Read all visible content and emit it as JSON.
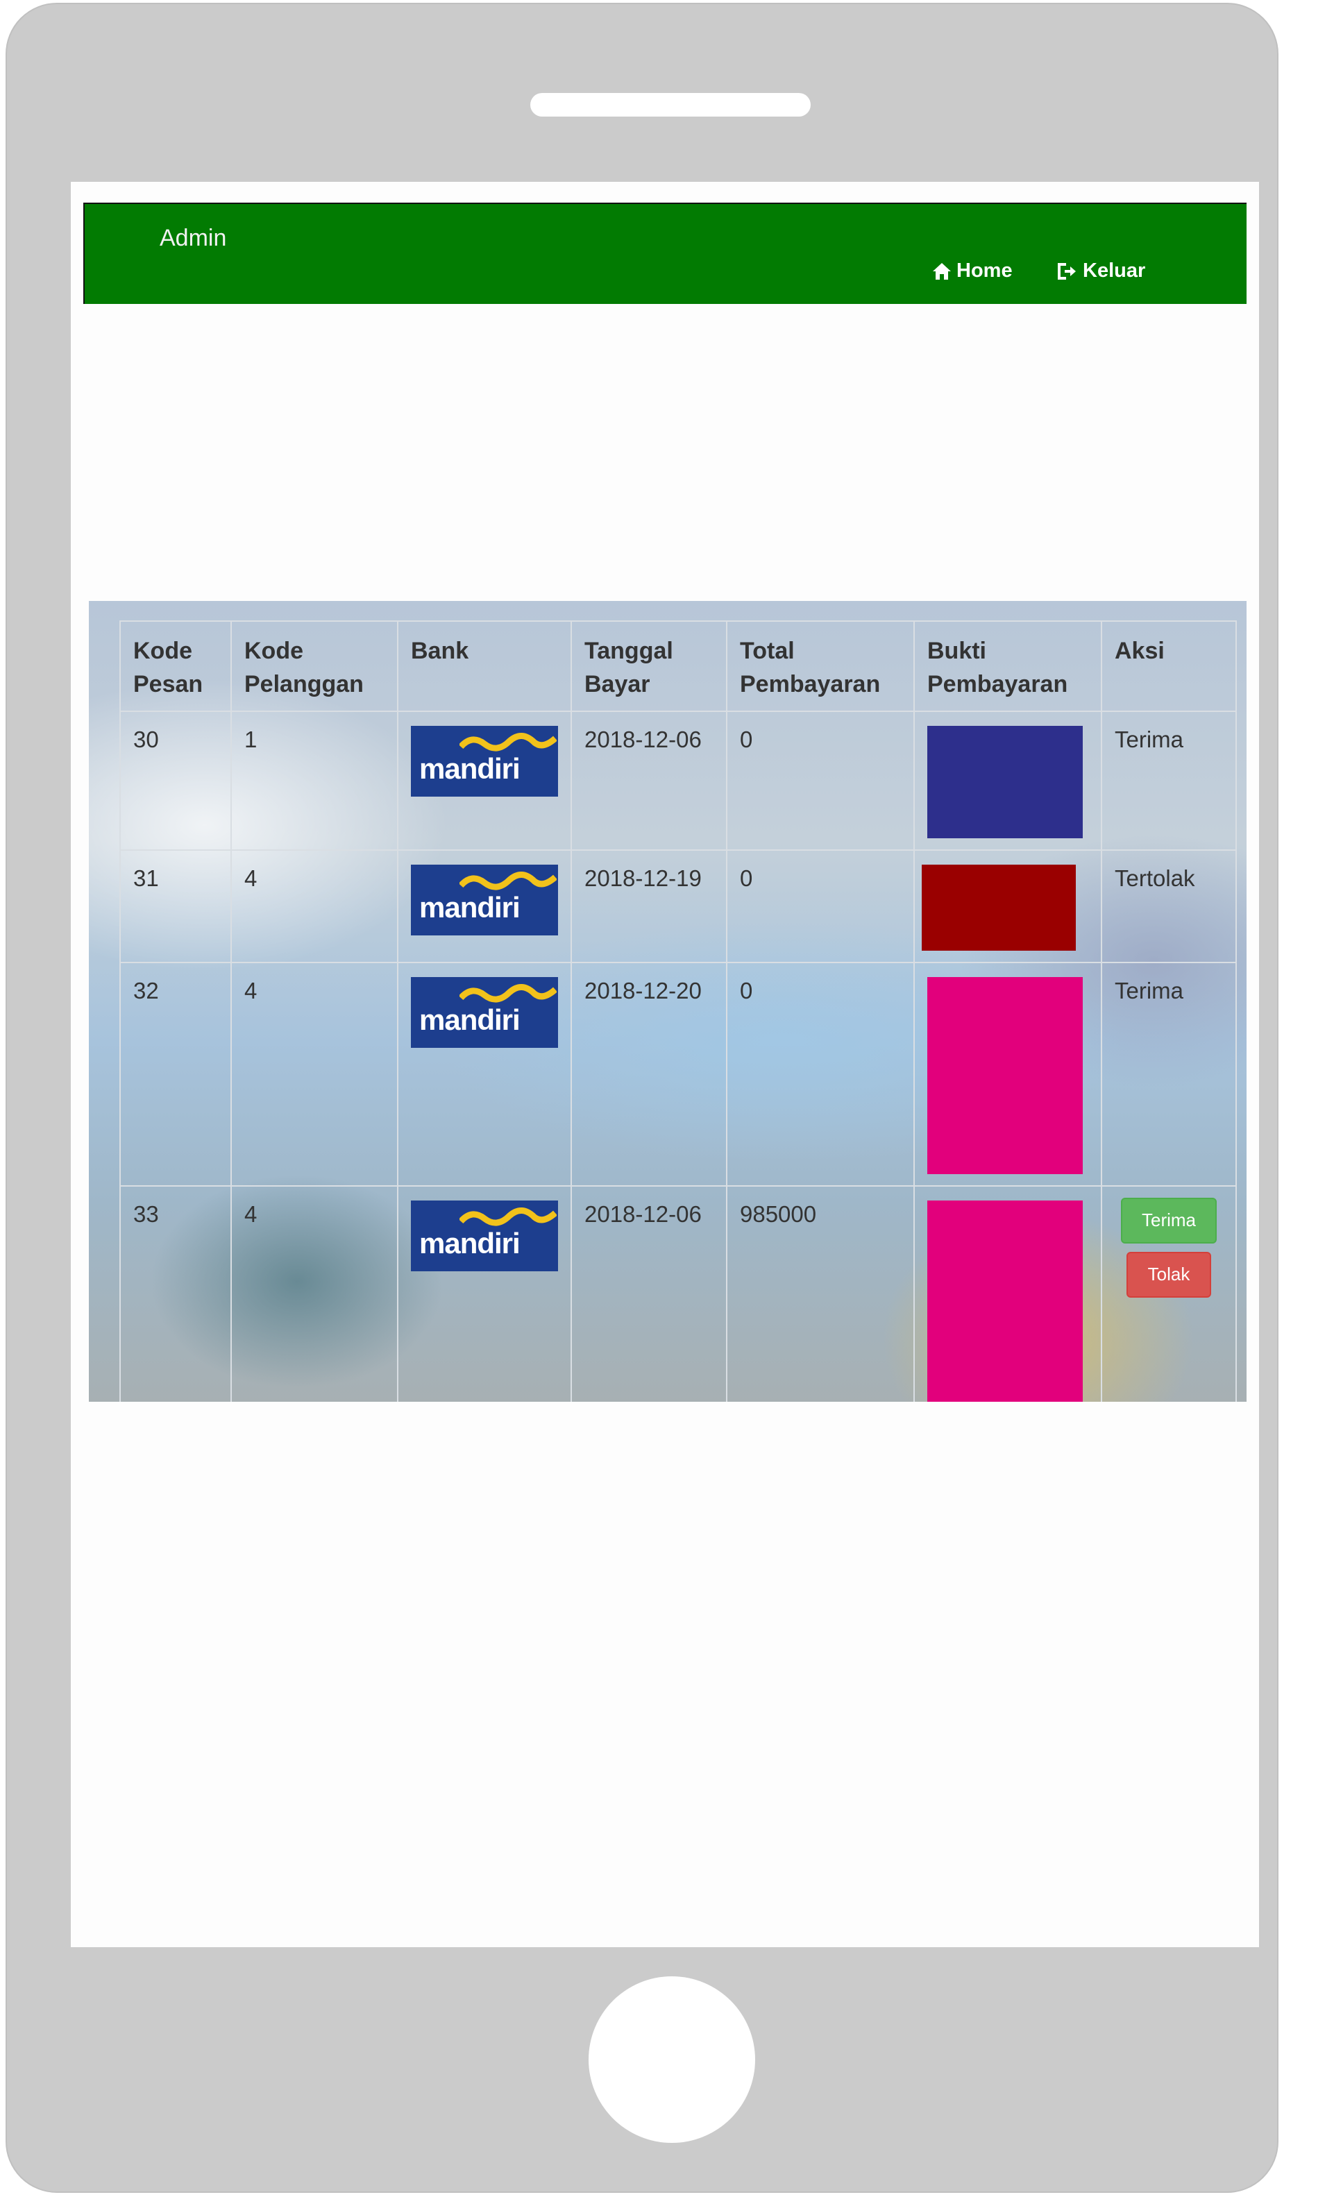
{
  "navbar": {
    "brand": "Admin",
    "home_label": "Home",
    "logout_label": "Keluar",
    "home_icon": "home-icon",
    "logout_icon": "sign-out-icon",
    "background_color": "#027b02"
  },
  "table": {
    "headers": [
      "Kode Pesan",
      "Kode Pelanggan",
      "Bank",
      "Tanggal Bayar",
      "Total Pembayaran",
      "Bukti Pembayaran",
      "Aksi"
    ],
    "rows": [
      {
        "kode_pesan": "30",
        "kode_pelanggan": "1",
        "bank": "mandiri",
        "tanggal": "2018-12-06",
        "total": "0",
        "proof_color": "#2d2f8c",
        "aksi": "Terima"
      },
      {
        "kode_pesan": "31",
        "kode_pelanggan": "4",
        "bank": "mandiri",
        "tanggal": "2018-12-19",
        "total": "0",
        "proof_color": "#9a0000",
        "aksi": "Tertolak"
      },
      {
        "kode_pesan": "32",
        "kode_pelanggan": "4",
        "bank": "mandiri",
        "tanggal": "2018-12-20",
        "total": "0",
        "proof_color": "#e2007c",
        "aksi": "Terima"
      },
      {
        "kode_pesan": "33",
        "kode_pelanggan": "4",
        "bank": "mandiri",
        "tanggal": "2018-12-06",
        "total": "985000",
        "proof_color": "#e2007c",
        "accept_label": "Terima",
        "reject_label": "Tolak"
      }
    ]
  },
  "colors": {
    "accept": "#5cb85c",
    "reject": "#d9534f",
    "bank_logo": "#1d3e8e"
  }
}
